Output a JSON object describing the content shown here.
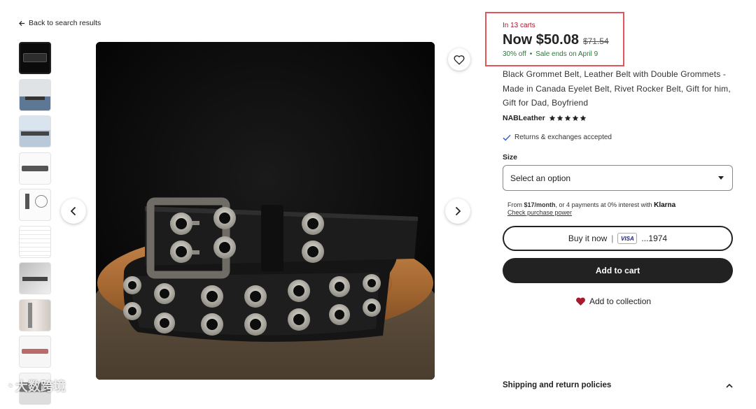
{
  "nav": {
    "back_label": "Back to search results"
  },
  "gallery": {
    "thumbnail_count": 10,
    "active_index": 0
  },
  "pricing": {
    "cart_badge": "In 13 carts",
    "price_now": "Now $50.08",
    "price_was": "$71.54",
    "discount": "30% off",
    "sale_end": "Sale ends on April 9"
  },
  "listing": {
    "title": "Black Grommet Belt, Leather Belt with Double Grommets - Made in Canada Eyelet Belt, Rivet Rocker Belt, Gift for him, Gift for Dad, Boyfriend",
    "shop_name": "NABLeather",
    "rating_stars": 5,
    "returns_text": "Returns & exchanges accepted"
  },
  "options": {
    "size_label": "Size",
    "size_select_value": "Select an option"
  },
  "financing": {
    "prefix": "From ",
    "amount": "$17/month",
    "middle": ", or 4 payments at 0% interest with ",
    "provider": "Klarna",
    "link": "Check purchase power"
  },
  "actions": {
    "buy_now_label": "Buy it now",
    "buy_now_separator": "|",
    "card_brand": "VISA",
    "card_last4": "...1974",
    "add_to_cart_label": "Add to cart",
    "add_to_collection_label": "Add to collection"
  },
  "sections": {
    "shipping_label": "Shipping and return policies"
  },
  "watermark": {
    "text": "大数跨境"
  },
  "colors": {
    "cart_badge": "#a61a2e",
    "sale_green": "#2c7a3b",
    "highlight_border": "#e0565b",
    "primary_button": "#222222",
    "collection_heart": "#a61a2e"
  }
}
